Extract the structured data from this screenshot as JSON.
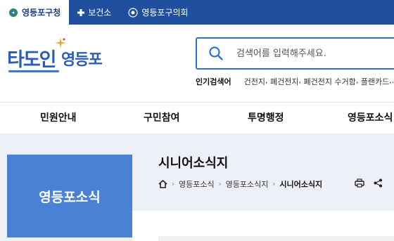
{
  "topbar": {
    "tabs": [
      {
        "label": "영등포구청",
        "icon": "district-logo-icon",
        "active": true
      },
      {
        "label": "보건소",
        "icon": "plus-icon",
        "active": false
      },
      {
        "label": "영등포구의회",
        "icon": "council-emblem-icon",
        "active": false
      }
    ]
  },
  "header": {
    "logo": {
      "part1": "타도인",
      "part2": "영등포"
    },
    "search": {
      "placeholder": "검색어를 입력해주세요."
    },
    "popular": {
      "label": "인기검색어",
      "items": [
        "건전지",
        "폐건전지",
        "폐건전지 수거함",
        "플랜카드"
      ],
      "trailing": "..."
    }
  },
  "gnb": {
    "items": [
      "민원안내",
      "구민참여",
      "투명행정",
      "영등포소식"
    ]
  },
  "sub": {
    "section_title": "영등포소식",
    "page_title": "시니어소식지",
    "breadcrumb": [
      "영등포소식",
      "영등포소식지",
      "시니어소식지"
    ]
  },
  "colors": {
    "topbar": "#1f4f9e",
    "accent": "#2f6fd8",
    "lnb": "#4a81d4",
    "subarea_bg": "#edf0f6"
  }
}
